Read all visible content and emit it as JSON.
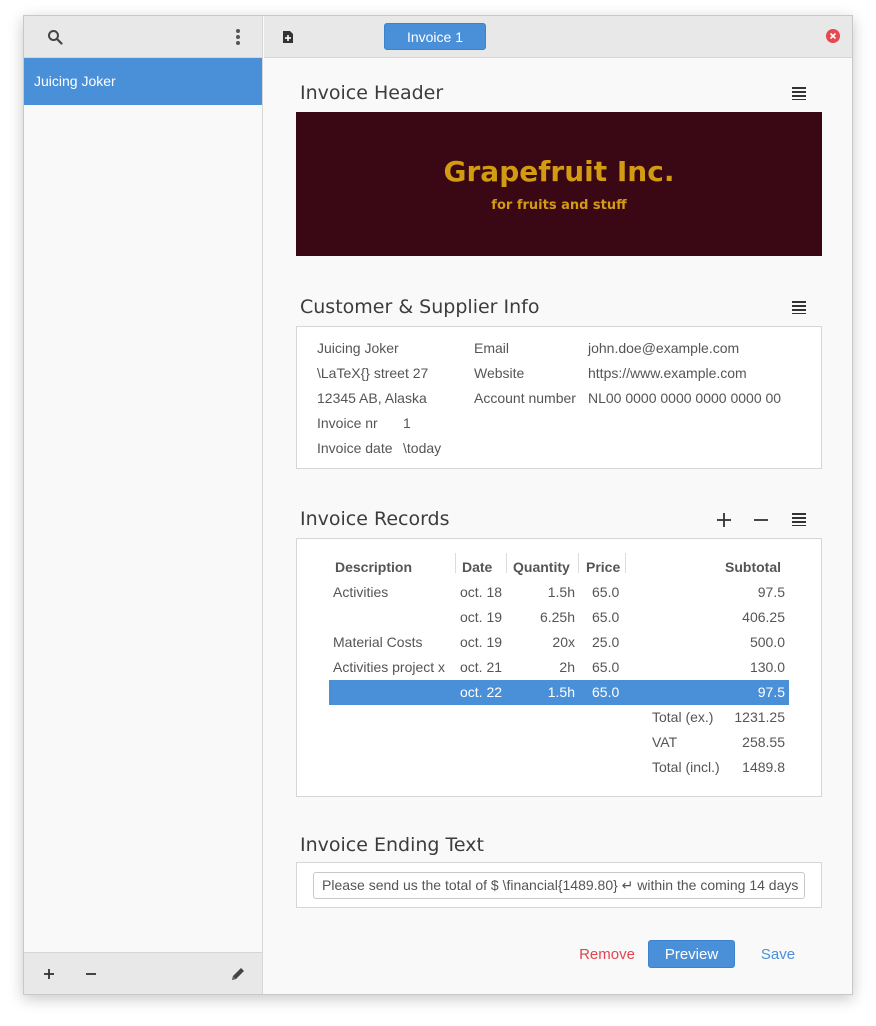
{
  "sidebar": {
    "items": [
      {
        "label": "Juicing Joker",
        "selected": true
      }
    ]
  },
  "topbar": {
    "tab_label": "Invoice 1"
  },
  "header_section": {
    "title": "Invoice Header",
    "company_name": "Grapefruit Inc.",
    "company_tagline": "for fruits and stuff",
    "banner_bg": "#3a0715",
    "banner_fg": "#d29b12"
  },
  "customer_section": {
    "title": "Customer & Supplier Info",
    "customer_name": "Juicing Joker",
    "street": "\\LaTeX{} street 27",
    "city": "12345 AB, Alaska",
    "invoice_nr_label": "Invoice nr",
    "invoice_nr_value": "1",
    "invoice_date_label": "Invoice date",
    "invoice_date_value": "\\today",
    "email_label": "Email",
    "email_value": "john.doe@example.com",
    "website_label": "Website",
    "website_value": "https://www.example.com",
    "account_label": "Account number",
    "account_value": "NL00 0000 0000 0000 0000 00"
  },
  "records_section": {
    "title": "Invoice Records",
    "columns": [
      "Description",
      "Date",
      "Quantity",
      "Price",
      "Subtotal"
    ],
    "rows": [
      {
        "description": "Activities",
        "date": "oct. 18",
        "quantity": "1.5h",
        "price": "65.0",
        "subtotal": "97.5"
      },
      {
        "description": "",
        "date": "oct. 19",
        "quantity": "6.25h",
        "price": "65.0",
        "subtotal": "406.25"
      },
      {
        "description": "Material Costs",
        "date": "oct. 19",
        "quantity": "20x",
        "price": "25.0",
        "subtotal": "500.0"
      },
      {
        "description": "Activities project x",
        "date": "oct. 21",
        "quantity": "2h",
        "price": "65.0",
        "subtotal": "130.0"
      },
      {
        "description": "",
        "date": "oct. 22",
        "quantity": "1.5h",
        "price": "65.0",
        "subtotal": "97.5"
      }
    ],
    "selected_row": 4,
    "totals": [
      {
        "label": "Total (ex.)",
        "value": "1231.25"
      },
      {
        "label": "VAT",
        "value": "258.55"
      },
      {
        "label": "Total (incl.)",
        "value": "1489.8"
      }
    ]
  },
  "ending_section": {
    "title": "Invoice Ending Text",
    "text": "Please send us the total of $ \\financial{1489.80} ↵ within the coming 14 days"
  },
  "actions": {
    "remove_label": "Remove",
    "preview_label": "Preview",
    "save_label": "Save"
  },
  "colors": {
    "accent": "#4a90d9",
    "danger": "#e0454e",
    "close": "#e8474f"
  }
}
